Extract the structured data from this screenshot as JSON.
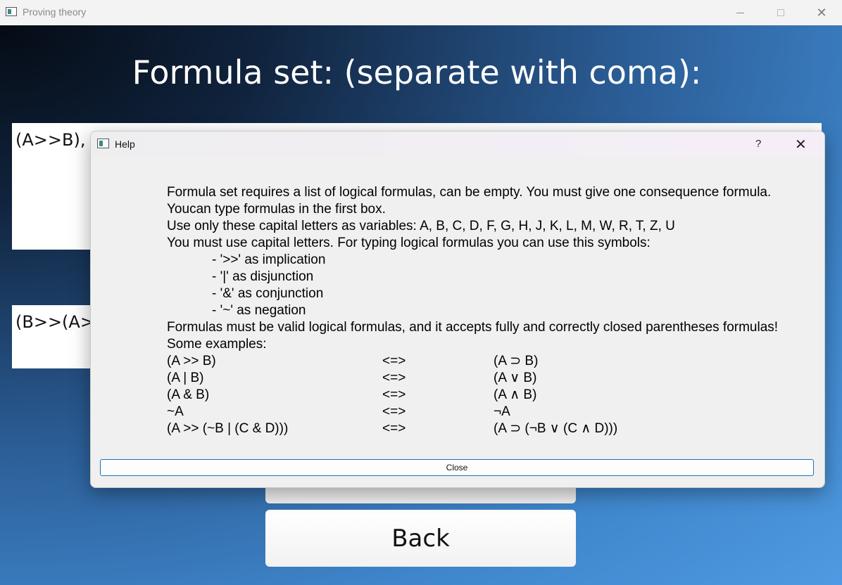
{
  "window": {
    "title": "Proving theory"
  },
  "main": {
    "heading": "Formula set: (separate with coma):",
    "formula_set_value": "(A>>B),",
    "consequence_value": "(B>>(A>",
    "back_label": "Back"
  },
  "dialog": {
    "title": "Help",
    "help_symbol": "?",
    "close_label": "Close",
    "lines": {
      "l1": "Formula set requires a list of logical formulas, can be empty. You must give one consequence formula.",
      "l2": "Youcan type formulas in the first box.",
      "l3": "Use only these capital letters as variables: A, B, C, D, F, G, H, J, K, L, M, W, R, T, Z, U",
      "l4": "You must use capital letters. For typing logical formulas you can use this symbols:",
      "s1": "- '>>' as implication",
      "s2": "- '|' as disjunction",
      "s3": "- '&' as conjunction",
      "s4": "- '~' as negation",
      "l5": "Formulas must be valid logical formulas, and it accepts fully and correctly closed parentheses formulas!",
      "l6": "Some examples:"
    },
    "examples": [
      {
        "input": "(A >> B)",
        "arrow": "<=>",
        "output": "(A ⊃ B)"
      },
      {
        "input": "(A | B)",
        "arrow": "<=>",
        "output": "(A ∨ B)"
      },
      {
        "input": "(A & B)",
        "arrow": "<=>",
        "output": "(A ∧ B)"
      },
      {
        "input": "~A",
        "arrow": "<=>",
        "output": "¬A"
      },
      {
        "input": "(A >> (~B | (C & D)))",
        "arrow": "<=>",
        "output": "(A ⊃ (¬B ∨ (C ∧ D)))"
      }
    ]
  }
}
